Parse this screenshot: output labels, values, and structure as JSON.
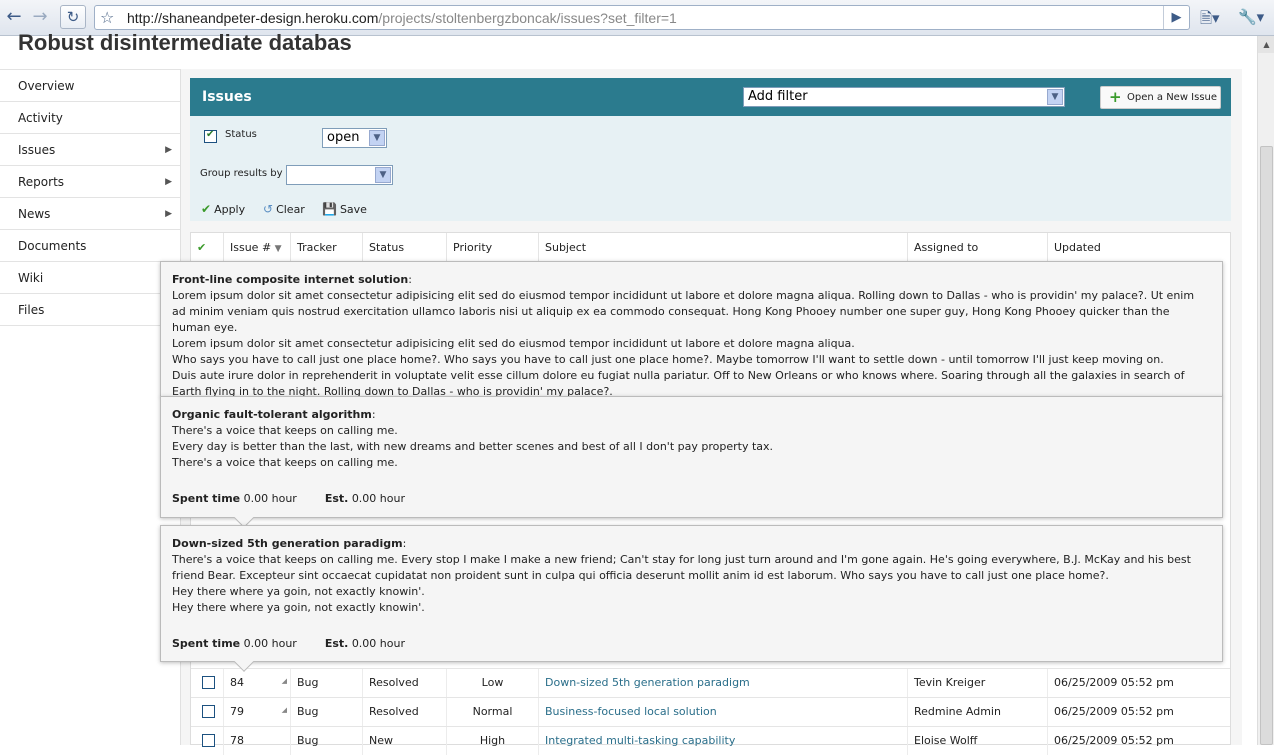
{
  "browser": {
    "url_host": "http://shaneandpeter-design.heroku.com",
    "url_path": "/projects/stoltenbergzboncak/issues?set_filter=1"
  },
  "page": {
    "title": "Robust disintermediate databas"
  },
  "sidebar": {
    "items": [
      {
        "label": "Overview",
        "arrow": false
      },
      {
        "label": "Activity",
        "arrow": false
      },
      {
        "label": "Issues",
        "arrow": true
      },
      {
        "label": "Reports",
        "arrow": true
      },
      {
        "label": "News",
        "arrow": true
      },
      {
        "label": "Documents",
        "arrow": false
      },
      {
        "label": "Wiki",
        "arrow": false
      },
      {
        "label": "Files",
        "arrow": false
      }
    ]
  },
  "issues_panel": {
    "title": "Issues",
    "add_filter": "Add filter",
    "new_issue": "Open a New Issue",
    "status_label": "Status",
    "status_value": "open",
    "group_by_label": "Group results by",
    "group_by_value": "",
    "apply": "Apply",
    "clear": "Clear",
    "save": "Save"
  },
  "table": {
    "headers": [
      "Issue #",
      "Tracker",
      "Status",
      "Priority",
      "Subject",
      "Assigned to",
      "Updated"
    ],
    "rows": [
      {
        "id": "84",
        "tracker": "Bug",
        "status": "Resolved",
        "priority": "Low",
        "subject": "Down-sized 5th generation paradigm",
        "assigned": "Tevin Kreiger",
        "updated": "06/25/2009 05:52 pm"
      },
      {
        "id": "79",
        "tracker": "Bug",
        "status": "Resolved",
        "priority": "Normal",
        "subject": "Business-focused local solution",
        "assigned": "Redmine Admin",
        "updated": "06/25/2009 05:52 pm"
      },
      {
        "id": "78",
        "tracker": "Bug",
        "status": "New",
        "priority": "High",
        "subject": "Integrated multi-tasking capability",
        "assigned": "Eloise Wolff",
        "updated": "06/25/2009 05:52 pm"
      }
    ]
  },
  "tooltips": [
    {
      "title": "Front-line composite internet solution",
      "lines": [
        "Lorem ipsum dolor sit amet consectetur adipisicing elit sed do eiusmod tempor incididunt ut labore et dolore magna aliqua. Rolling down to Dallas - who is providin' my palace?. Ut enim ad minim veniam quis nostrud exercitation ullamco laboris nisi ut aliquip ex ea commodo consequat. Hong Kong Phooey number one super guy, Hong Kong Phooey quicker than the human eye.",
        "Lorem ipsum dolor sit amet consectetur adipisicing elit sed do eiusmod tempor incididunt ut labore et dolore magna aliqua.",
        "Who says you have to call just one place home?. Who says you have to call just one place home?. Maybe tomorrow I'll want to settle down - until tomorrow I'll just keep moving on.",
        "Duis aute irure dolor in reprehenderit in voluptate velit esse cillum dolore eu fugiat nulla pariatur. Off to New Orleans or who knows where. Soaring through all the galaxies in search of Earth flying in to the night. Rolling down to Dallas - who is providin' my palace?."
      ]
    },
    {
      "title": "Organic fault-tolerant algorithm",
      "lines": [
        "There's a voice that keeps on calling me.",
        "Every day is better than the last, with new dreams and better scenes and best of all I don't pay property tax.",
        "There's a voice that keeps on calling me."
      ],
      "spent_label": "Spent time",
      "spent": "0.00 hour",
      "est_label": "Est.",
      "est": "0.00 hour"
    },
    {
      "title": "Down-sized 5th generation paradigm",
      "lines": [
        "There's a voice that keeps on calling me. Every stop I make I make a new friend; Can't stay for long just turn around and I'm gone again. He's going everywhere, B.J. McKay and his best friend Bear. Excepteur sint occaecat cupidatat non proident sunt in culpa qui officia deserunt mollit anim id est laborum. Who says you have to call just one place home?.",
        "Hey there where ya goin, not exactly knowin'.",
        "Hey there where ya goin, not exactly knowin'."
      ],
      "spent_label": "Spent time",
      "spent": "0.00 hour",
      "est_label": "Est.",
      "est": "0.00 hour"
    }
  ]
}
